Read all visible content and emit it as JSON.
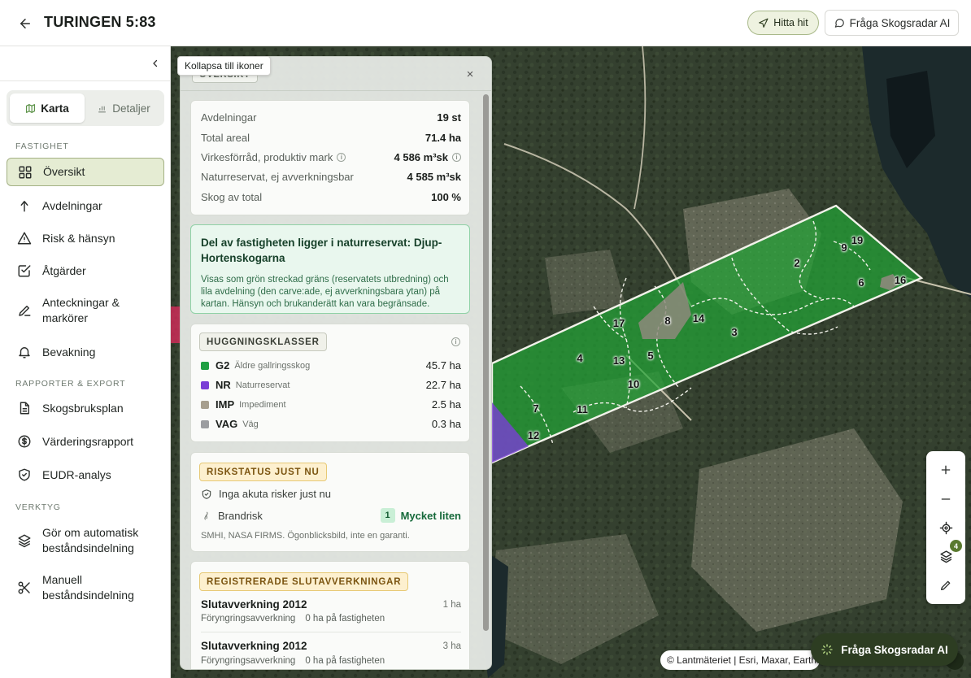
{
  "header": {
    "title": "TURINGEN 5:83",
    "hitta_hit": "Hitta hit",
    "fraga_ai": "Fråga Skogsradar AI"
  },
  "sidebar": {
    "tooltip": "Kollapsa till ikoner",
    "view_tabs": [
      {
        "label": "Karta",
        "icon": "map-icon"
      },
      {
        "label": "Detaljer",
        "icon": "bar-chart-icon"
      }
    ],
    "sections": {
      "fastighet": "FASTIGHET",
      "rapporter": "RAPPORTER & EXPORT",
      "verktyg": "VERKTYG"
    },
    "items": [
      {
        "label": "Översikt",
        "icon": "grid-icon"
      },
      {
        "label": "Avdelningar",
        "icon": "tree-icon"
      },
      {
        "label": "Risk & hänsyn",
        "icon": "warning-icon"
      },
      {
        "label": "Åtgärder",
        "icon": "checkbox-icon"
      },
      {
        "label": "Anteckningar &",
        "label2": "markörer",
        "icon": "pencil-icon"
      },
      {
        "label": "Bevakning",
        "icon": "bell-icon"
      },
      {
        "label": "Skogsbruksplan",
        "icon": "document-icon"
      },
      {
        "label": "Värderingsrapport",
        "icon": "dollar-icon"
      },
      {
        "label": "EUDR-analys",
        "icon": "shield-check-icon"
      },
      {
        "label": "Gör om automatisk",
        "label2": "beståndsindelning",
        "icon": "layers-icon"
      },
      {
        "label": "Manuell",
        "label2": "beståndsindelning",
        "icon": "scissors-icon"
      }
    ]
  },
  "panel": {
    "chip": "ÖVERSIKT",
    "close": "×",
    "stats": [
      {
        "key": "Avdelningar",
        "value": "19 st"
      },
      {
        "key": "Total areal",
        "value": "71.4 ha"
      },
      {
        "key": "Virkesförråd, produktiv mark",
        "value": "4 586 m³sk"
      },
      {
        "key": "Naturreservat, ej avverkningsbar",
        "value": "4 585 m³sk"
      },
      {
        "key": "Skog av total",
        "value": "100 %"
      }
    ],
    "naturreservat": {
      "title": "Del av fastigheten ligger i naturreservat: Djup-Hortenskogarna",
      "desc": "Visas som grön streckad gräns (reservatets utbredning) och lila avdelning (den carve:ade, ej avverkningsbara ytan) på kartan. Hänsyn och brukanderätt kan vara begränsade."
    },
    "huggningsklasser": {
      "title": "HUGGNINGSKLASSER",
      "rows": [
        {
          "code": "G2",
          "desc": "Äldre gallringsskog",
          "value": "45.7 ha",
          "color": "#1fa043"
        },
        {
          "code": "NR",
          "desc": "Naturreservat",
          "value": "22.7 ha",
          "color": "#7a3fd6"
        },
        {
          "code": "IMP",
          "desc": "Impediment",
          "value": "2.5 ha",
          "color": "#a79f8f"
        },
        {
          "code": "VAG",
          "desc": "Väg",
          "value": "0.3 ha",
          "color": "#9b9da0"
        }
      ]
    },
    "riskstatus": {
      "title": "RISKSTATUS JUST NU",
      "none": "Inga akuta risker just nu",
      "brandrisk": "Brandrisk",
      "level_num": "1",
      "level_text": "Mycket liten",
      "source": "SMHI, NASA FIRMS. Ögonblicksbild, inte en garanti."
    },
    "slutavverkningar": {
      "title": "REGISTRERADE SLUTAVVERKNINGAR",
      "items": [
        {
          "title": "Slutavverkning 2012",
          "area": "1 ha",
          "type": "Föryngringsavverkning",
          "onprop": "0 ha på fastigheten"
        },
        {
          "title": "Slutavverkning 2012",
          "area": "3 ha",
          "type": "Föryngringsavverkning",
          "onprop": "0 ha på fastigheten"
        }
      ]
    }
  },
  "map": {
    "stand_labels": [
      "2",
      "3",
      "4",
      "5",
      "6",
      "7",
      "8",
      "9",
      "10",
      "11",
      "12",
      "13",
      "14",
      "16",
      "17",
      "19"
    ],
    "tools": [
      "plus-icon",
      "minus-icon",
      "locate-icon",
      "layers-icon",
      "pencil-icon"
    ],
    "layer_count": "4",
    "attribution": "© Lantmäteriet | Esri, Maxar, Earthstar",
    "ask_ai": "Fråga Skogsradar AI"
  }
}
